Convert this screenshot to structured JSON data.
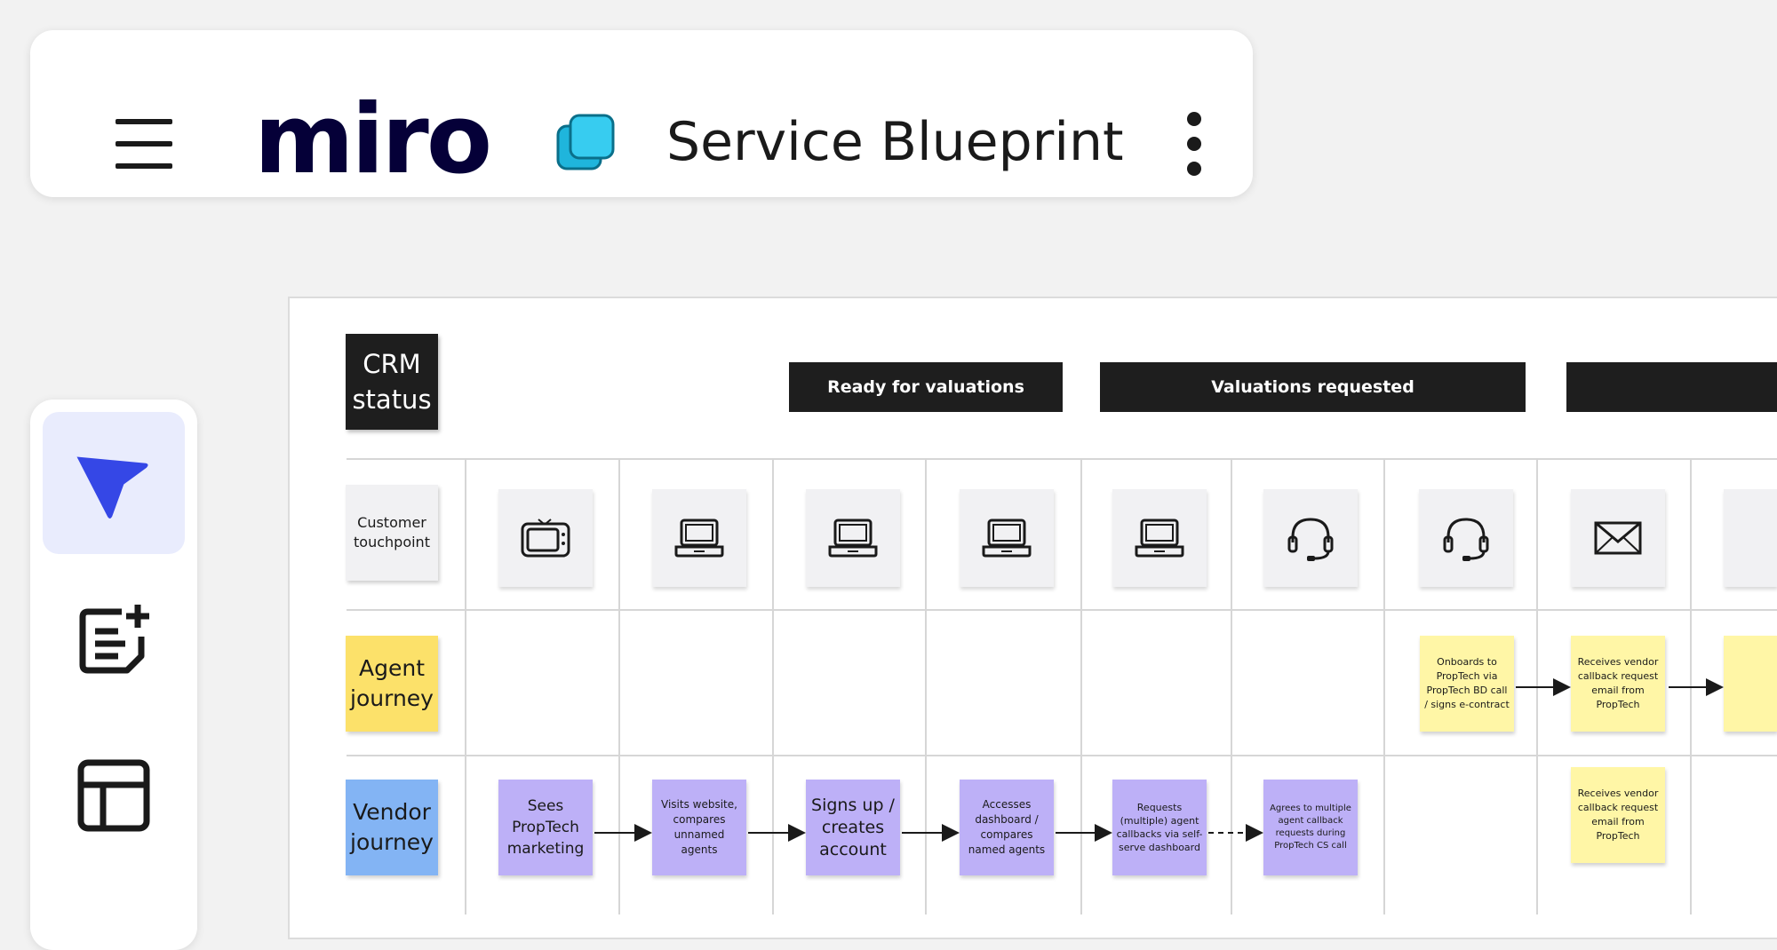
{
  "topbar": {
    "logo": "miro",
    "board_title": "Service Blueprint",
    "accent": "#2ec3e8"
  },
  "toolbar": {
    "tools": [
      "select-arrow",
      "add-note",
      "templates"
    ],
    "active": "select-arrow",
    "active_color": "#3547e6"
  },
  "blueprint": {
    "crm_label": "CRM status",
    "phases": [
      "Ready for valuations",
      "Valuations requested",
      ""
    ],
    "row_labels": {
      "touchpoint": "Customer touchpoint",
      "agent": "Agent journey",
      "vendor": "Vendor journey"
    },
    "row_colors": {
      "agent": "#fce16a",
      "vendor": "#83b4f4"
    },
    "touchpoints": [
      "tv",
      "laptop",
      "laptop",
      "laptop",
      "laptop",
      "headset",
      "headset",
      "envelope",
      ""
    ],
    "agent_notes": [
      "Onboards to PropTech via PropTech BD call / signs e-contract",
      "Receives vendor callback request email from PropTech",
      ""
    ],
    "vendor_notes": [
      "Sees PropTech marketing",
      "Visits website, compares unnamed agents",
      "Signs up / creates account",
      "Accesses dashboard / compares named agents",
      "Requests (multiple) agent callbacks via self-serve dashboard",
      "Agrees to multiple agent callback requests during PropTech CS call",
      "Receives vendor callback request email from PropTech"
    ]
  }
}
